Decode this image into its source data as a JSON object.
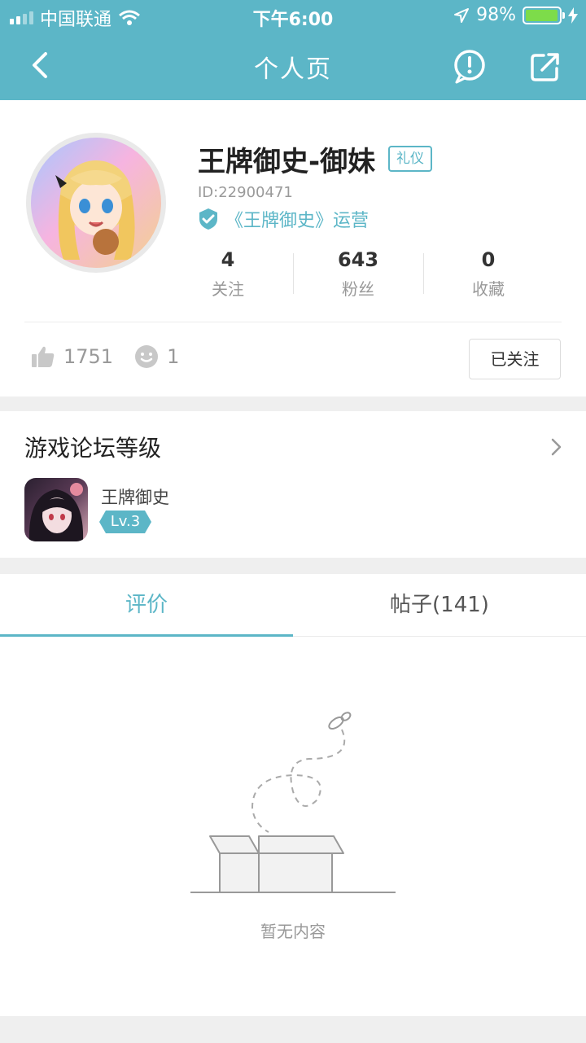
{
  "status_bar": {
    "carrier": "中国联通",
    "time": "下午6:00",
    "battery": "98%",
    "battery_level": 0.98
  },
  "nav": {
    "title": "个人页"
  },
  "profile": {
    "name": "王牌御史-御妹",
    "tag": "礼仪",
    "id_text": "ID:22900471",
    "verify_text": "《王牌御史》运营",
    "stats": [
      {
        "value": "4",
        "label": "关注"
      },
      {
        "value": "643",
        "label": "粉丝"
      },
      {
        "value": "0",
        "label": "收藏"
      }
    ],
    "likes": "1751",
    "reactions": "1",
    "follow_label": "已关注"
  },
  "forum": {
    "title": "游戏论坛等级",
    "game_name": "王牌御史",
    "level": "Lv.3"
  },
  "tabs": [
    {
      "label": "评价",
      "active": true
    },
    {
      "label": "帖子(141)",
      "active": false
    }
  ],
  "empty": {
    "message": "暂无内容"
  },
  "colors": {
    "accent": "#5cb6c7",
    "battery": "#7ddc4a"
  }
}
